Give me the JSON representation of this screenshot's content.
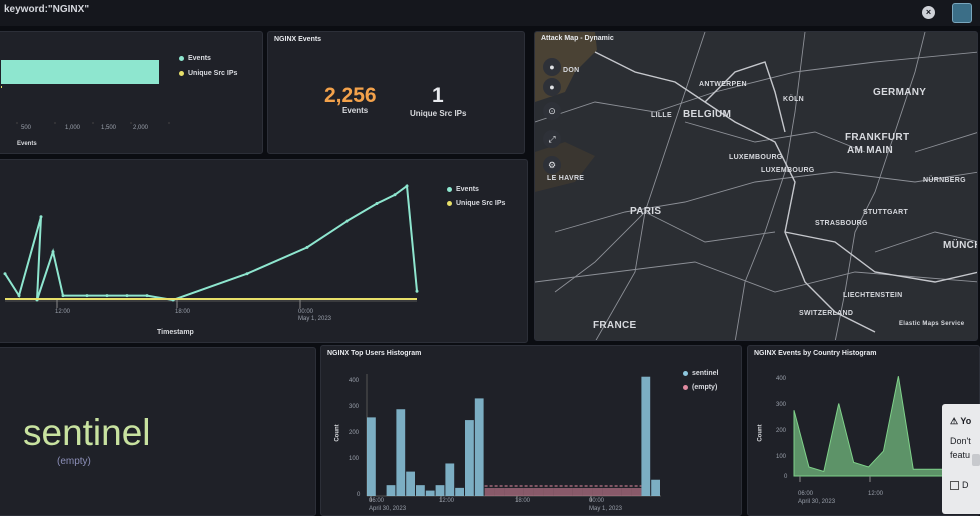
{
  "query": "keyword:\"NGINX\"",
  "colors": {
    "events": "#8ee6cf",
    "unique": "#e8e06a",
    "accent_orange": "#f3a24b",
    "bar_blue": "#8dc7de",
    "bar_pink": "#e08aa0",
    "bar_green": "#7fd18a"
  },
  "panel_bar": {
    "legend": [
      "Events",
      "Unique Src IPs"
    ],
    "ticks": [
      "500",
      "1,000",
      "1,500",
      "2,000"
    ],
    "xlabel": "Events",
    "chart_data": {
      "type": "bar",
      "orientation": "horizontal",
      "series": [
        {
          "name": "Events",
          "values": [
            2256
          ]
        },
        {
          "name": "Unique Src IPs",
          "values": [
            1
          ]
        }
      ],
      "xlim": [
        0,
        2256
      ]
    }
  },
  "panel_metric": {
    "title": "NGINX Events",
    "events_value": "2,256",
    "events_label": "Events",
    "unique_value": "1",
    "unique_label": "Unique Src IPs"
  },
  "panel_line": {
    "legend": [
      "Events",
      "Unique Src IPs"
    ],
    "ticks": [
      "12:00",
      "18:00",
      "00:00",
      "May 1, 2023"
    ],
    "xlabel": "Timestamp",
    "chart_data": {
      "type": "line",
      "x": [
        0,
        1,
        2,
        3,
        4,
        5,
        6,
        7,
        8,
        9,
        10,
        11,
        12,
        13,
        14,
        15,
        16,
        17
      ],
      "series": [
        {
          "name": "Events",
          "values": [
            60,
            10,
            190,
            0,
            110,
            10,
            10,
            10,
            10,
            10,
            0,
            60,
            120,
            180,
            220,
            240,
            260,
            20
          ]
        },
        {
          "name": "Unique Src IPs",
          "values": [
            1,
            1,
            1,
            1,
            1,
            1,
            1,
            1,
            1,
            1,
            1,
            1,
            1,
            1,
            1,
            1,
            1,
            1
          ]
        }
      ]
    }
  },
  "map": {
    "title": "Attack Map - Dynamic",
    "attribution": "Elastic Maps Service",
    "labels": [
      {
        "t": "DON"
      },
      {
        "t": "ANTWERPEN"
      },
      {
        "t": "BELGIUM"
      },
      {
        "t": "LILLE"
      },
      {
        "t": "KÖLN"
      },
      {
        "t": "GERMANY"
      },
      {
        "t": "FRANKFURT"
      },
      {
        "t": "AM MAIN"
      },
      {
        "t": "LUXEMBOURG"
      },
      {
        "t": "LUXEMBOURG"
      },
      {
        "t": "LE HAVRE"
      },
      {
        "t": "PARIS"
      },
      {
        "t": "NÜRNBERG"
      },
      {
        "t": "STUTTGART"
      },
      {
        "t": "STRASBOURG"
      },
      {
        "t": "MÜNCH"
      },
      {
        "t": "LIECHTENSTEIN"
      },
      {
        "t": "SWITZERLAND"
      },
      {
        "t": "FRANCE"
      }
    ]
  },
  "sentinel": {
    "word": "sentinel",
    "sub": "(empty)"
  },
  "top_users": {
    "title": "NGINX Top Users Histogram",
    "legend": [
      "sentinel",
      "(empty)"
    ],
    "ylabel": "Count",
    "yticks": [
      "400",
      "300",
      "200",
      "100",
      "0"
    ],
    "xticks": [
      "06:00",
      "April 30, 2023",
      "12:00",
      "18:00",
      "00:00",
      "May 1, 2023"
    ],
    "chart_data": {
      "type": "bar",
      "series": [
        {
          "name": "sentinel",
          "values": [
            290,
            0,
            40,
            320,
            90,
            40,
            20,
            40,
            120,
            30,
            280,
            360,
            0,
            0,
            0,
            0,
            0,
            0,
            0,
            0,
            0,
            0,
            0,
            0,
            0,
            0,
            0,
            0,
            440,
            60
          ]
        },
        {
          "name": "(empty)",
          "values": [
            0,
            0,
            0,
            0,
            0,
            0,
            0,
            0,
            0,
            0,
            0,
            0,
            80,
            80,
            80,
            80,
            80,
            80,
            80,
            80,
            80,
            80,
            80,
            80,
            80,
            80,
            80,
            80,
            0,
            0
          ]
        }
      ],
      "ylim": [
        0,
        450
      ]
    }
  },
  "country": {
    "title": "NGINX Events by Country Histogram",
    "ylabel": "Count",
    "yticks": [
      "400",
      "300",
      "200",
      "100",
      "0"
    ],
    "xticks": [
      "06:00",
      "April 30, 2023",
      "12:00"
    ],
    "chart_data": {
      "type": "area",
      "series": [
        {
          "name": "",
          "values": [
            290,
            40,
            20,
            320,
            60,
            40,
            110,
            440,
            30,
            30,
            30,
            30
          ]
        }
      ],
      "ylim": [
        0,
        450
      ]
    }
  },
  "popup": {
    "warn": "Yo",
    "line1": "Don't",
    "line2": "featu",
    "check": "D"
  }
}
